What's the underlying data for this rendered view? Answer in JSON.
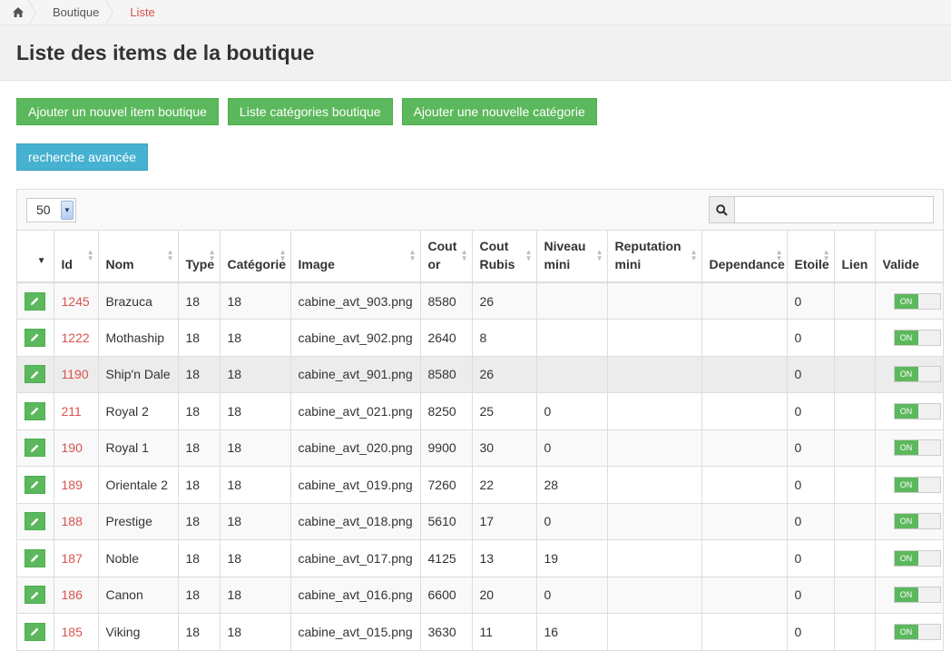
{
  "breadcrumb": {
    "items": [
      "Boutique",
      "Liste"
    ]
  },
  "page": {
    "title": "Liste des items de la boutique"
  },
  "buttons": {
    "add_item": "Ajouter un nouvel item boutique",
    "list_categories": "Liste catégories boutique",
    "add_category": "Ajouter une nouvelle catégorie",
    "advanced_search": "recherche avancée"
  },
  "toolbar": {
    "page_size": "50",
    "search_placeholder": ""
  },
  "table": {
    "headers": [
      "",
      "Id",
      "Nom",
      "Type",
      "Catégorie",
      "Image",
      "Cout or",
      "Cout Rubis",
      "Niveau mini",
      "Reputation mini",
      "Dependance",
      "Etoile",
      "Lien",
      "Valide"
    ],
    "toggle_label": "ON",
    "rows": [
      {
        "id": "1245",
        "nom": "Brazuca",
        "type": "18",
        "categorie": "18",
        "image": "cabine_avt_903.png",
        "or": "8580",
        "rubis": "26",
        "niveau": "",
        "reputation": "",
        "dependance": "",
        "etoile": "0",
        "lien": "",
        "valide": "ON"
      },
      {
        "id": "1222",
        "nom": "Mothaship",
        "type": "18",
        "categorie": "18",
        "image": "cabine_avt_902.png",
        "or": "2640",
        "rubis": "8",
        "niveau": "",
        "reputation": "",
        "dependance": "",
        "etoile": "0",
        "lien": "",
        "valide": "ON"
      },
      {
        "id": "1190",
        "nom": "Ship'n Dale",
        "type": "18",
        "categorie": "18",
        "image": "cabine_avt_901.png",
        "or": "8580",
        "rubis": "26",
        "niveau": "",
        "reputation": "",
        "dependance": "",
        "etoile": "0",
        "lien": "",
        "valide": "ON"
      },
      {
        "id": "211",
        "nom": "Royal 2",
        "type": "18",
        "categorie": "18",
        "image": "cabine_avt_021.png",
        "or": "8250",
        "rubis": "25",
        "niveau": "0",
        "reputation": "",
        "dependance": "",
        "etoile": "0",
        "lien": "",
        "valide": "ON"
      },
      {
        "id": "190",
        "nom": "Royal 1",
        "type": "18",
        "categorie": "18",
        "image": "cabine_avt_020.png",
        "or": "9900",
        "rubis": "30",
        "niveau": "0",
        "reputation": "",
        "dependance": "",
        "etoile": "0",
        "lien": "",
        "valide": "ON"
      },
      {
        "id": "189",
        "nom": "Orientale 2",
        "type": "18",
        "categorie": "18",
        "image": "cabine_avt_019.png",
        "or": "7260",
        "rubis": "22",
        "niveau": "28",
        "reputation": "",
        "dependance": "",
        "etoile": "0",
        "lien": "",
        "valide": "ON"
      },
      {
        "id": "188",
        "nom": "Prestige",
        "type": "18",
        "categorie": "18",
        "image": "cabine_avt_018.png",
        "or": "5610",
        "rubis": "17",
        "niveau": "0",
        "reputation": "",
        "dependance": "",
        "etoile": "0",
        "lien": "",
        "valide": "ON"
      },
      {
        "id": "187",
        "nom": "Noble",
        "type": "18",
        "categorie": "18",
        "image": "cabine_avt_017.png",
        "or": "4125",
        "rubis": "13",
        "niveau": "19",
        "reputation": "",
        "dependance": "",
        "etoile": "0",
        "lien": "",
        "valide": "ON"
      },
      {
        "id": "186",
        "nom": "Canon",
        "type": "18",
        "categorie": "18",
        "image": "cabine_avt_016.png",
        "or": "6600",
        "rubis": "20",
        "niveau": "0",
        "reputation": "",
        "dependance": "",
        "etoile": "0",
        "lien": "",
        "valide": "ON"
      },
      {
        "id": "185",
        "nom": "Viking",
        "type": "18",
        "categorie": "18",
        "image": "cabine_avt_015.png",
        "or": "3630",
        "rubis": "11",
        "niveau": "16",
        "reputation": "",
        "dependance": "",
        "etoile": "0",
        "lien": "",
        "valide": "ON"
      }
    ]
  },
  "colors": {
    "accent_red": "#d9534f",
    "green": "#5cb85c",
    "info": "#46b1d0"
  },
  "icons": {
    "home": "home-icon",
    "search": "search-icon",
    "edit": "pencil-icon"
  }
}
